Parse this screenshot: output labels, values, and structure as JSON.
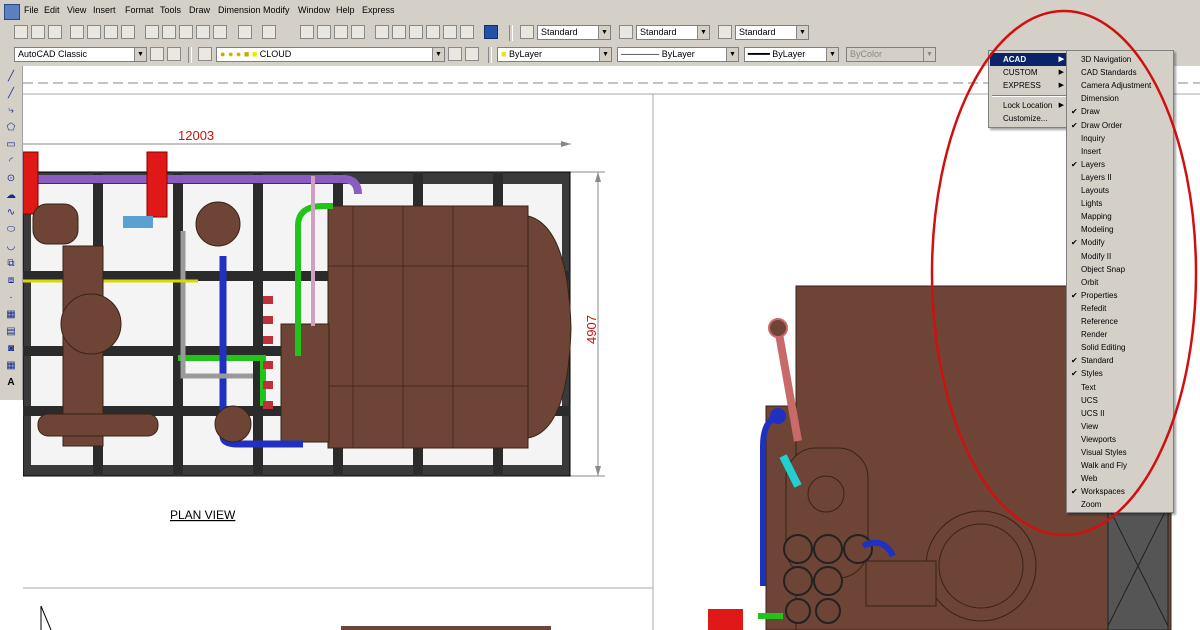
{
  "menubar": {
    "items": [
      "File",
      "Edit",
      "View",
      "Insert",
      "Format",
      "Tools",
      "Draw",
      "Dimension",
      "Modify",
      "Window",
      "Help",
      "Express"
    ]
  },
  "toolbar1": {
    "text_style": "Standard",
    "dim_style": "Standard",
    "table_style": "Standard"
  },
  "toolbar2": {
    "workspace": "AutoCAD Classic",
    "layer": "CLOUD",
    "color": "ByLayer",
    "linetype": "ByLayer",
    "lineweight": "ByLayer",
    "plot_style": "ByColor"
  },
  "drawing": {
    "plan_label": "PLAN VIEW",
    "dim_horizontal": "12003",
    "dim_vertical": "4907"
  },
  "context_menu": {
    "items": [
      {
        "label": "ACAD",
        "submenu": true,
        "selected": true
      },
      {
        "label": "CUSTOM",
        "submenu": true
      },
      {
        "label": "EXPRESS",
        "submenu": true
      },
      {
        "label": "Lock Location",
        "submenu": true
      },
      {
        "label": "Customize..."
      }
    ]
  },
  "toolbars_menu": {
    "items": [
      {
        "label": "3D Navigation",
        "checked": false
      },
      {
        "label": "CAD Standards",
        "checked": false
      },
      {
        "label": "Camera Adjustment",
        "checked": false
      },
      {
        "label": "Dimension",
        "checked": false
      },
      {
        "label": "Draw",
        "checked": true
      },
      {
        "label": "Draw Order",
        "checked": true
      },
      {
        "label": "Inquiry",
        "checked": false
      },
      {
        "label": "Insert",
        "checked": false
      },
      {
        "label": "Layers",
        "checked": true
      },
      {
        "label": "Layers II",
        "checked": false
      },
      {
        "label": "Layouts",
        "checked": false
      },
      {
        "label": "Lights",
        "checked": false
      },
      {
        "label": "Mapping",
        "checked": false
      },
      {
        "label": "Modeling",
        "checked": false
      },
      {
        "label": "Modify",
        "checked": true
      },
      {
        "label": "Modify II",
        "checked": false
      },
      {
        "label": "Object Snap",
        "checked": false
      },
      {
        "label": "Orbit",
        "checked": false
      },
      {
        "label": "Properties",
        "checked": true
      },
      {
        "label": "Refedit",
        "checked": false
      },
      {
        "label": "Reference",
        "checked": false
      },
      {
        "label": "Render",
        "checked": false
      },
      {
        "label": "Solid Editing",
        "checked": false
      },
      {
        "label": "Standard",
        "checked": true
      },
      {
        "label": "Styles",
        "checked": true
      },
      {
        "label": "Text",
        "checked": false
      },
      {
        "label": "UCS",
        "checked": false
      },
      {
        "label": "UCS II",
        "checked": false
      },
      {
        "label": "View",
        "checked": false
      },
      {
        "label": "Viewports",
        "checked": false
      },
      {
        "label": "Visual Styles",
        "checked": false
      },
      {
        "label": "Walk and Fly",
        "checked": false
      },
      {
        "label": "Web",
        "checked": false
      },
      {
        "label": "Workspaces",
        "checked": true
      },
      {
        "label": "Zoom",
        "checked": false
      }
    ]
  },
  "colors": {
    "equipment_brown": "#6e4436",
    "menu_highlight": "#0a246a",
    "annotation_red": "#d01010",
    "pipe_green": "#22c41a",
    "pipe_purple": "#8a5cc0",
    "pipe_blue": "#2030c0"
  }
}
